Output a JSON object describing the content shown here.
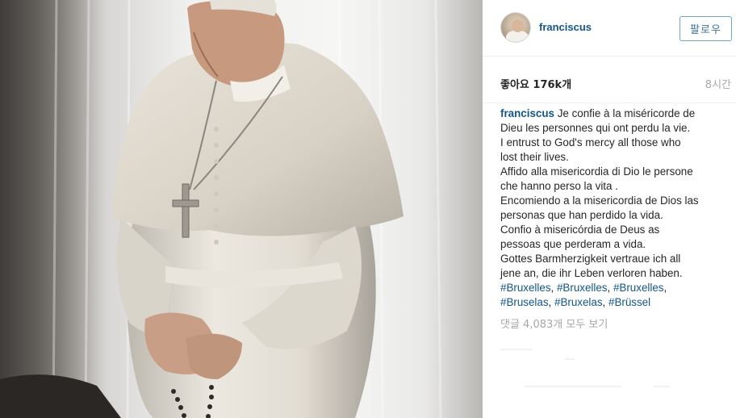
{
  "post": {
    "username": "franciscus",
    "follow_label": "팔로우",
    "likes": "좋아요 176k개",
    "time_ago": "8시간",
    "caption_user": "franciscus",
    "caption_lines": [
      "Je confie à la miséricorde de",
      "Dieu les personnes qui ont perdu la vie.",
      "I entrust to God's mercy all those who",
      "lost their lives.",
      "Affido alla misericordia di Dio le persone",
      "che hanno perso la vita .",
      "Encomiendo a la misericordia de Dios las",
      "personas que han perdido la vida.",
      "Confio à misericórdia de Deus as",
      "pessoas que perderam a vida.",
      "Gottes Barmherzigkeit vertraue ich all",
      "jene an, die ihr Leben verloren haben."
    ],
    "hashtags_line1": [
      "#Bruxelles",
      "#Bruxelles",
      "#Bruxelles"
    ],
    "hashtags_line2": [
      "#Bruselas",
      "#Bruxelas",
      "#Brüssel"
    ],
    "view_comments": "댓글 4,083개 모두 보기"
  },
  "colors": {
    "link_blue": "#125688",
    "button_border": "#70a3cc",
    "muted_gray": "#a5a7aa"
  },
  "icons": {
    "avatar": "profile-photo",
    "photo": "pope-praying-photo"
  }
}
